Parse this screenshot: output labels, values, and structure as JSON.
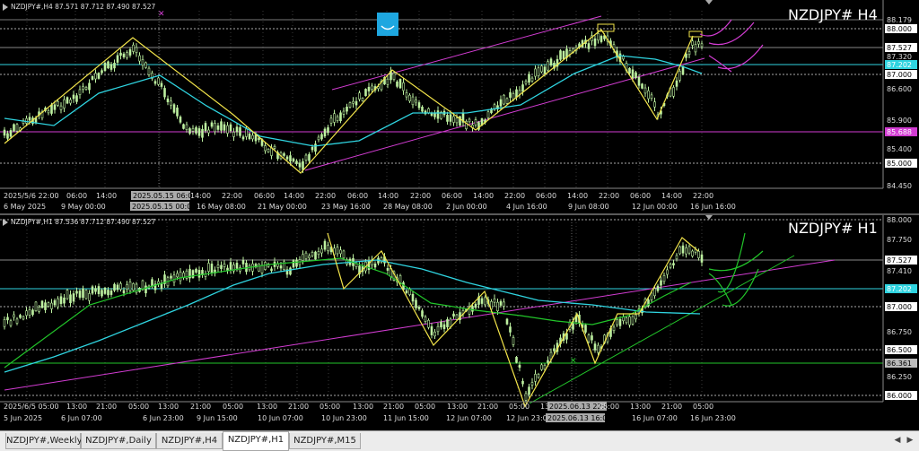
{
  "charts": [
    {
      "id": "h4",
      "ohlc_label": "NZDJPY#,H4  87.571 87.712 87.490 87.527",
      "title": "NZDJPY# H4",
      "price_axis": [
        "88.179",
        "88.000",
        "87.527",
        "87.320",
        "87.202",
        "87.000",
        "86.600",
        "85.900",
        "85.688",
        "85.400",
        "85.000",
        "84.450"
      ],
      "price_highlight": {
        "bid": "87.527",
        "cyan": "87.202",
        "magenta": "85.688",
        "white1": "88.000",
        "white2": "87.000",
        "white3": "85.000"
      },
      "time_axis": [
        "2025/5/6 22:00",
        "06:00",
        "14:00",
        "2025.05.15 06:00",
        "14:00",
        "22:00",
        "06:00",
        "14:00",
        "22:00",
        "06:00",
        "14:00",
        "22:00",
        "06:00",
        "14:00",
        "22:00",
        "06:00",
        "14:00",
        "22:00",
        "06:00",
        "14:00",
        "22:00"
      ],
      "date_axis": [
        "6 May 2025",
        "9 May 00:00",
        "2025.05.15 00:00",
        "16 May 08:00",
        "21 May 00:00",
        "23 May 16:00",
        "28 May 08:00",
        "2 Jun 00:00",
        "4 Jun 16:00",
        "9 Jun 08:00",
        "12 Jun 00:00",
        "16 Jun 16:00"
      ]
    },
    {
      "id": "h1",
      "ohlc_label": "NZDJPY#,H1  87.536 87.712 87.490 87.527",
      "title": "NZDJPY# H1",
      "price_axis": [
        "88.000",
        "87.750",
        "87.527",
        "87.410",
        "87.202",
        "87.000",
        "86.750",
        "86.500",
        "86.361",
        "86.250",
        "86.000"
      ],
      "price_highlight": {
        "bid": "87.527",
        "cyan": "87.202",
        "green": "86.361",
        "white1": "87.000",
        "white2": "86.500",
        "white3": "86.000"
      },
      "time_axis": [
        "2025/6/5 05:00",
        "13:00",
        "21:00",
        "05:00",
        "13:00",
        "21:00",
        "05:00",
        "13:00",
        "21:00",
        "05:00",
        "13:00",
        "21:00",
        "05:00",
        "13:00",
        "21:00",
        "05:00",
        "13:00",
        "2025.06.13 22:00",
        "05:00",
        "13:00",
        "21:00",
        "05:00"
      ],
      "date_axis": [
        "5 Jun 2025",
        "6 Jun 07:00",
        "6 Jun 23:00",
        "9 Jun 15:00",
        "10 Jun 07:00",
        "10 Jun 23:00",
        "11 Jun 15:00",
        "12 Jun 07:00",
        "12 Jun 23:00",
        "2025.06.13 16:00",
        "16 Jun 07:00",
        "16 Jun 23:00"
      ]
    }
  ],
  "tabs": [
    "NZDJPY#,Weekly",
    "NZDJPY#,Daily",
    "NZDJPY#,H4",
    "NZDJPY#,H1",
    "NZDJPY#,M15"
  ],
  "active_tab": "NZDJPY#,H1",
  "colors": {
    "bg": "#000000",
    "candle": "#bdf0a0",
    "ma_cyan": "#2fd4e0",
    "zigzag": "#f2e44a",
    "channel": "#d23cd2",
    "green_line": "#22c52a",
    "grid": "#3a3a3a"
  },
  "icons": {
    "scroll_left": "triangle-left-icon",
    "scroll_right": "triangle-right-icon",
    "indicator": "smile-icon"
  }
}
